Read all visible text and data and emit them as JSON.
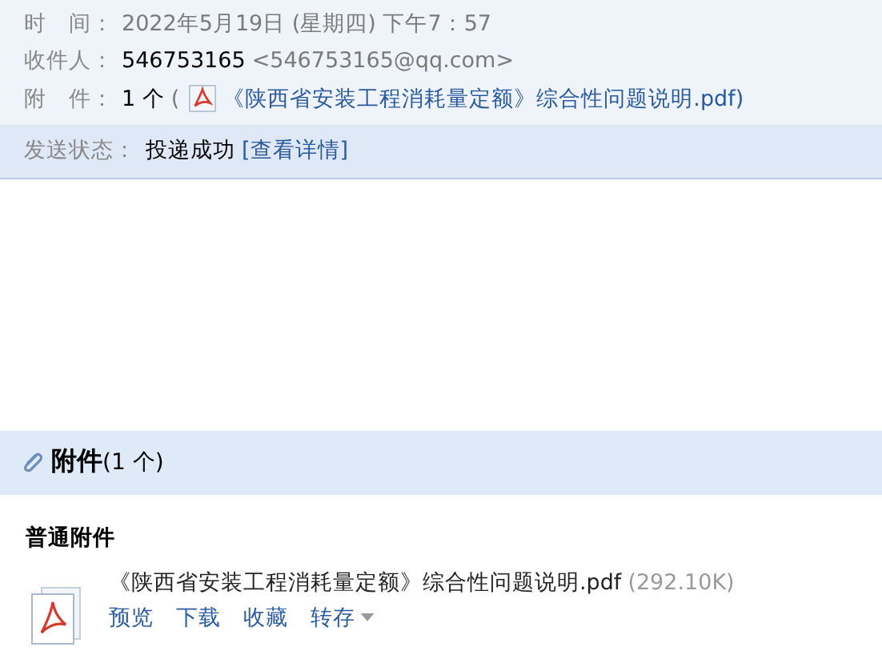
{
  "header": {
    "time": {
      "label": "时　间：",
      "value": "2022年5月19日 (星期四) 下午7：57"
    },
    "recipient": {
      "label": "收件人：",
      "name": "546753165",
      "email": "<546753165@qq.com>"
    },
    "attachment": {
      "label": "附　件：",
      "count": "1 个",
      "open": "(",
      "file": "《陕西省安装工程消耗量定额》综合性问题说明.pdf",
      "close": ")"
    }
  },
  "status": {
    "label": "发送状态：",
    "value": "投递成功",
    "link": "[查看详情]"
  },
  "attachments": {
    "title": "附件",
    "count": "(1 个)",
    "group": "普通附件",
    "files": [
      {
        "name": "《陕西省安装工程消耗量定额》综合性问题说明.pdf",
        "size": "(292.10K)",
        "actions": [
          "预览",
          "下载",
          "收藏",
          "转存"
        ]
      }
    ]
  }
}
